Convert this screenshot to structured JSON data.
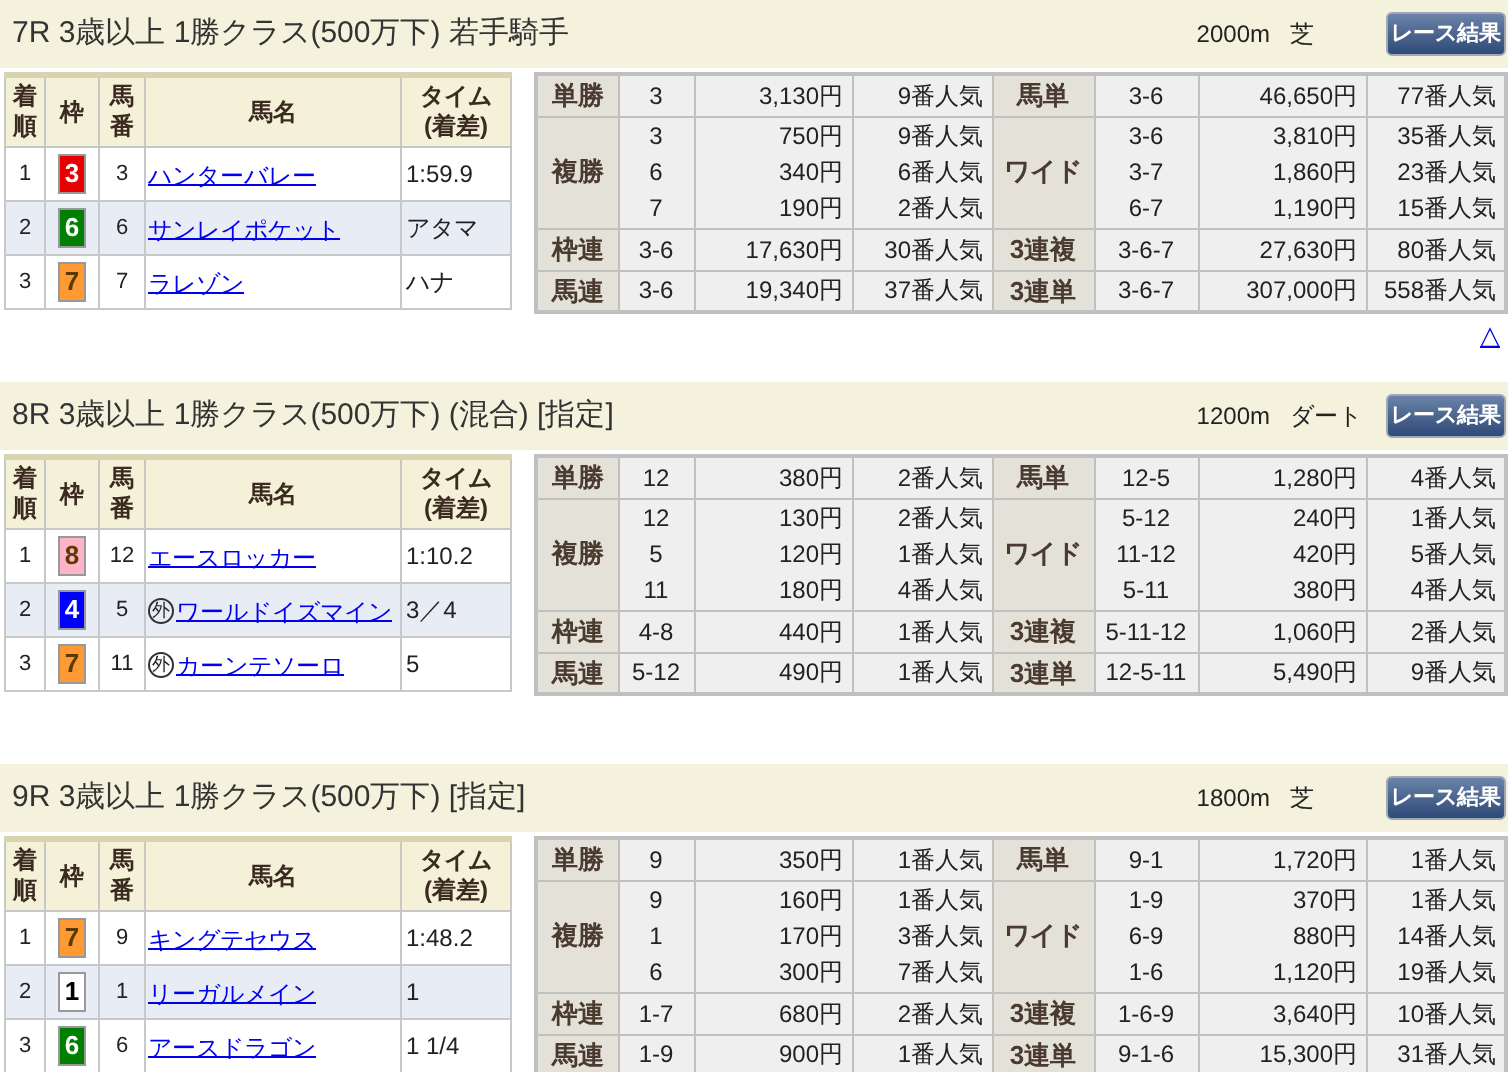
{
  "races": [
    {
      "title": "7R 3歳以上 1勝クラス(500万下) 若手騎手",
      "distance": "2000m",
      "surface": "芝",
      "button": "レース結果",
      "top_link": "△",
      "columns": [
        [
          "着",
          "順"
        ],
        [
          "枠"
        ],
        [
          "馬",
          "番"
        ],
        [
          "馬名"
        ],
        [
          "タイム",
          "(着差)"
        ]
      ],
      "results": [
        {
          "place": "1",
          "frame": "3",
          "color": "#e60000",
          "number": "3",
          "name": "ハンターバレー",
          "time": "1:59.9",
          "selected": false
        },
        {
          "place": "2",
          "frame": "6",
          "color": "#008000",
          "number": "6",
          "name": "サンレイポケット",
          "time": "アタマ",
          "selected": true
        },
        {
          "place": "3",
          "frame": "7",
          "color": "#ff9933",
          "number": "7",
          "name": "ラレゾン",
          "time": "ハナ",
          "selected": false
        }
      ],
      "payouts": [
        {
          "left": {
            "type": "単勝",
            "entries": [
              {
                "combo": "3",
                "amount": "3,130円",
                "popularity": "9番人気"
              }
            ]
          },
          "right": {
            "type": "馬単",
            "entries": [
              {
                "combo": "3-6",
                "amount": "46,650円",
                "popularity": "77番人気"
              }
            ]
          }
        },
        {
          "left": {
            "type": "複勝",
            "entries": [
              {
                "combo": "3",
                "amount": "750円",
                "popularity": "9番人気"
              },
              {
                "combo": "6",
                "amount": "340円",
                "popularity": "6番人気"
              },
              {
                "combo": "7",
                "amount": "190円",
                "popularity": "2番人気"
              }
            ]
          },
          "right": {
            "type": "ワイド",
            "entries": [
              {
                "combo": "3-6",
                "amount": "3,810円",
                "popularity": "35番人気"
              },
              {
                "combo": "3-7",
                "amount": "1,860円",
                "popularity": "23番人気"
              },
              {
                "combo": "6-7",
                "amount": "1,190円",
                "popularity": "15番人気"
              }
            ]
          }
        },
        {
          "left": {
            "type": "枠連",
            "entries": [
              {
                "combo": "3-6",
                "amount": "17,630円",
                "popularity": "30番人気"
              }
            ]
          },
          "right": {
            "type": "3連複",
            "entries": [
              {
                "combo": "3-6-7",
                "amount": "27,630円",
                "popularity": "80番人気"
              }
            ]
          }
        },
        {
          "left": {
            "type": "馬連",
            "entries": [
              {
                "combo": "3-6",
                "amount": "19,340円",
                "popularity": "37番人気"
              }
            ]
          },
          "right": {
            "type": "3連単",
            "entries": [
              {
                "combo": "3-6-7",
                "amount": "307,000円",
                "popularity": "558番人気"
              }
            ]
          }
        }
      ]
    },
    {
      "title": "8R 3歳以上 1勝クラス(500万下) (混合) [指定]",
      "distance": "1200m",
      "surface": "ダート",
      "button": "レース結果",
      "columns": [
        [
          "着",
          "順"
        ],
        [
          "枠"
        ],
        [
          "馬",
          "番"
        ],
        [
          "馬名"
        ],
        [
          "タイム",
          "(着差)"
        ]
      ],
      "results": [
        {
          "place": "1",
          "frame": "8",
          "color": "#ffb3c6",
          "number": "12",
          "name": "エースロッカー",
          "time": "1:10.2",
          "selected": false
        },
        {
          "place": "2",
          "frame": "4",
          "color": "#0000ff",
          "number": "5",
          "mark": "外",
          "name": "ワールドイズマイン",
          "time": "3／4",
          "selected": true
        },
        {
          "place": "3",
          "frame": "7",
          "color": "#ff9933",
          "number": "11",
          "mark": "外",
          "name": "カーンテソーロ",
          "time": "5",
          "selected": false
        }
      ],
      "payouts": [
        {
          "left": {
            "type": "単勝",
            "entries": [
              {
                "combo": "12",
                "amount": "380円",
                "popularity": "2番人気"
              }
            ]
          },
          "right": {
            "type": "馬単",
            "entries": [
              {
                "combo": "12-5",
                "amount": "1,280円",
                "popularity": "4番人気"
              }
            ]
          }
        },
        {
          "left": {
            "type": "複勝",
            "entries": [
              {
                "combo": "12",
                "amount": "130円",
                "popularity": "2番人気"
              },
              {
                "combo": "5",
                "amount": "120円",
                "popularity": "1番人気"
              },
              {
                "combo": "11",
                "amount": "180円",
                "popularity": "4番人気"
              }
            ]
          },
          "right": {
            "type": "ワイド",
            "entries": [
              {
                "combo": "5-12",
                "amount": "240円",
                "popularity": "1番人気"
              },
              {
                "combo": "11-12",
                "amount": "420円",
                "popularity": "5番人気"
              },
              {
                "combo": "5-11",
                "amount": "380円",
                "popularity": "4番人気"
              }
            ]
          }
        },
        {
          "left": {
            "type": "枠連",
            "entries": [
              {
                "combo": "4-8",
                "amount": "440円",
                "popularity": "1番人気"
              }
            ]
          },
          "right": {
            "type": "3連複",
            "entries": [
              {
                "combo": "5-11-12",
                "amount": "1,060円",
                "popularity": "2番人気"
              }
            ]
          }
        },
        {
          "left": {
            "type": "馬連",
            "entries": [
              {
                "combo": "5-12",
                "amount": "490円",
                "popularity": "1番人気"
              }
            ]
          },
          "right": {
            "type": "3連単",
            "entries": [
              {
                "combo": "12-5-11",
                "amount": "5,490円",
                "popularity": "9番人気"
              }
            ]
          }
        }
      ]
    },
    {
      "title": "9R 3歳以上 1勝クラス(500万下) [指定]",
      "distance": "1800m",
      "surface": "芝",
      "button": "レース結果",
      "columns": [
        [
          "着",
          "順"
        ],
        [
          "枠"
        ],
        [
          "馬",
          "番"
        ],
        [
          "馬名"
        ],
        [
          "タイム",
          "(着差)"
        ]
      ],
      "results": [
        {
          "place": "1",
          "frame": "7",
          "color": "#ff9933",
          "number": "9",
          "name": "キングテセウス",
          "time": "1:48.2",
          "selected": false
        },
        {
          "place": "2",
          "frame": "1",
          "color": "#ffffff",
          "number": "1",
          "name": "リーガルメイン",
          "time": "1",
          "selected": true
        },
        {
          "place": "3",
          "frame": "6",
          "color": "#008000",
          "number": "6",
          "name": "アースドラゴン",
          "time": "1 1/4",
          "selected": false
        }
      ],
      "payouts": [
        {
          "left": {
            "type": "単勝",
            "entries": [
              {
                "combo": "9",
                "amount": "350円",
                "popularity": "1番人気"
              }
            ]
          },
          "right": {
            "type": "馬単",
            "entries": [
              {
                "combo": "9-1",
                "amount": "1,720円",
                "popularity": "1番人気"
              }
            ]
          }
        },
        {
          "left": {
            "type": "複勝",
            "entries": [
              {
                "combo": "9",
                "amount": "160円",
                "popularity": "1番人気"
              },
              {
                "combo": "1",
                "amount": "170円",
                "popularity": "3番人気"
              },
              {
                "combo": "6",
                "amount": "300円",
                "popularity": "7番人気"
              }
            ]
          },
          "right": {
            "type": "ワイド",
            "entries": [
              {
                "combo": "1-9",
                "amount": "370円",
                "popularity": "1番人気"
              },
              {
                "combo": "6-9",
                "amount": "880円",
                "popularity": "14番人気"
              },
              {
                "combo": "1-6",
                "amount": "1,120円",
                "popularity": "19番人気"
              }
            ]
          }
        },
        {
          "left": {
            "type": "枠連",
            "entries": [
              {
                "combo": "1-7",
                "amount": "680円",
                "popularity": "2番人気"
              }
            ]
          },
          "right": {
            "type": "3連複",
            "entries": [
              {
                "combo": "1-6-9",
                "amount": "3,640円",
                "popularity": "10番人気"
              }
            ]
          }
        },
        {
          "left": {
            "type": "馬連",
            "entries": [
              {
                "combo": "1-9",
                "amount": "900円",
                "popularity": "1番人気"
              }
            ]
          },
          "right": {
            "type": "3連単",
            "entries": [
              {
                "combo": "9-1-6",
                "amount": "15,300円",
                "popularity": "31番人気"
              }
            ]
          }
        }
      ]
    }
  ]
}
